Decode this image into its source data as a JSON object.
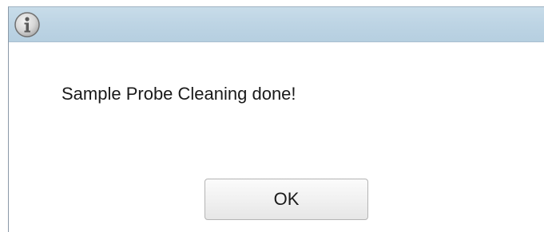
{
  "dialog": {
    "icon": "info-icon",
    "message": "Sample Probe Cleaning done!",
    "ok_label": "OK"
  },
  "colors": {
    "titlebar": "#bdd4e4",
    "background": "#ffffff",
    "text": "#1a1a1a"
  }
}
